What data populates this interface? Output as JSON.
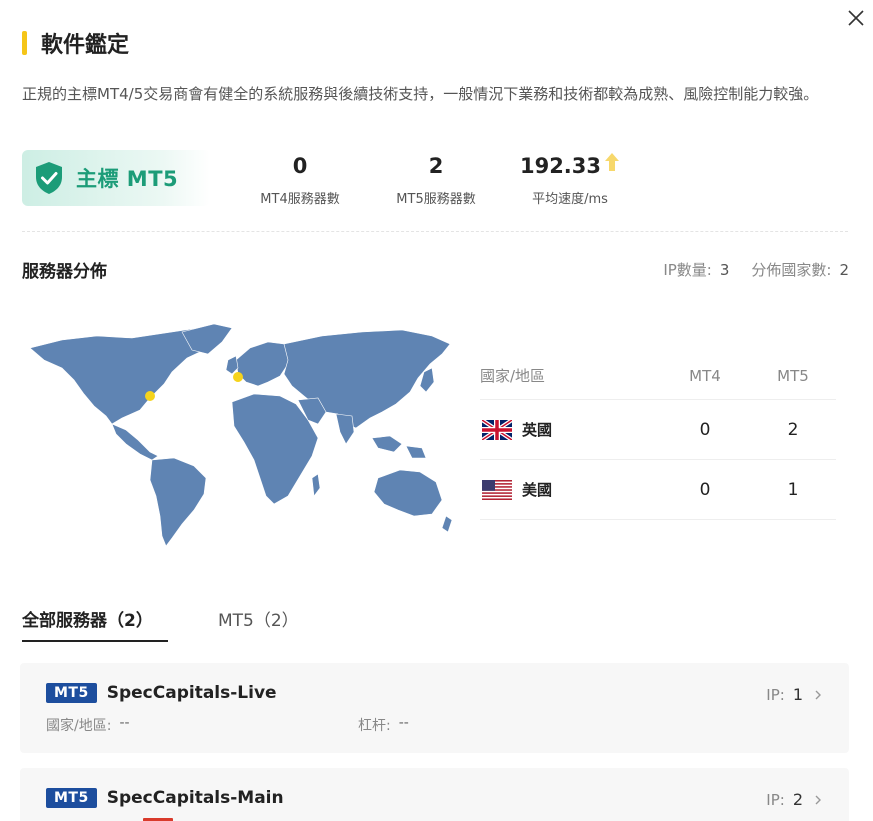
{
  "header": {
    "title": "軟件鑑定"
  },
  "description": "正規的主標MT4/5交易商會有健全的系統服務與後續技術支持，一般情況下業務和技術都較為成熟、風險控制能力較強。",
  "badge": {
    "label": "主標 MT5",
    "icon": "shield-check-icon",
    "color": "#1c9c78"
  },
  "stats": {
    "mt4_servers": {
      "value": "0",
      "label": "MT4服務器數"
    },
    "mt5_servers": {
      "value": "2",
      "label": "MT5服務器數"
    },
    "avg_speed": {
      "value": "192.33",
      "label": "平均速度/ms",
      "icon": "arrow-up-icon"
    }
  },
  "distribution": {
    "title": "服務器分佈",
    "ip_count_label": "IP數量:",
    "ip_count": "3",
    "country_count_label": "分佈國家數:",
    "country_count": "2"
  },
  "country_table": {
    "headers": {
      "country": "國家/地區",
      "mt4": "MT4",
      "mt5": "MT5"
    },
    "rows": [
      {
        "flag": "uk-flag-icon",
        "name": "英國",
        "mt4": "0",
        "mt5": "2"
      },
      {
        "flag": "us-flag-icon",
        "name": "美國",
        "mt4": "0",
        "mt5": "1"
      }
    ]
  },
  "tabs": [
    {
      "label": "全部服務器（2）",
      "active": true
    },
    {
      "label": "MT5（2）",
      "active": false
    }
  ],
  "servers": [
    {
      "tag": "MT5",
      "name": "SpecCapitals-Live",
      "ip_label": "IP:",
      "ip": "1",
      "country_label": "國家/地區:",
      "country": "--",
      "leverage_label": "杠杆:",
      "leverage": "--"
    },
    {
      "tag": "MT5",
      "name": "SpecCapitals-Main",
      "ip_label": "IP:",
      "ip": "2"
    }
  ],
  "colors": {
    "accent": "#f5c518",
    "map_land": "#5f84b3",
    "map_marker": "#f5d31c",
    "tag_blue": "#1d4e9e"
  }
}
